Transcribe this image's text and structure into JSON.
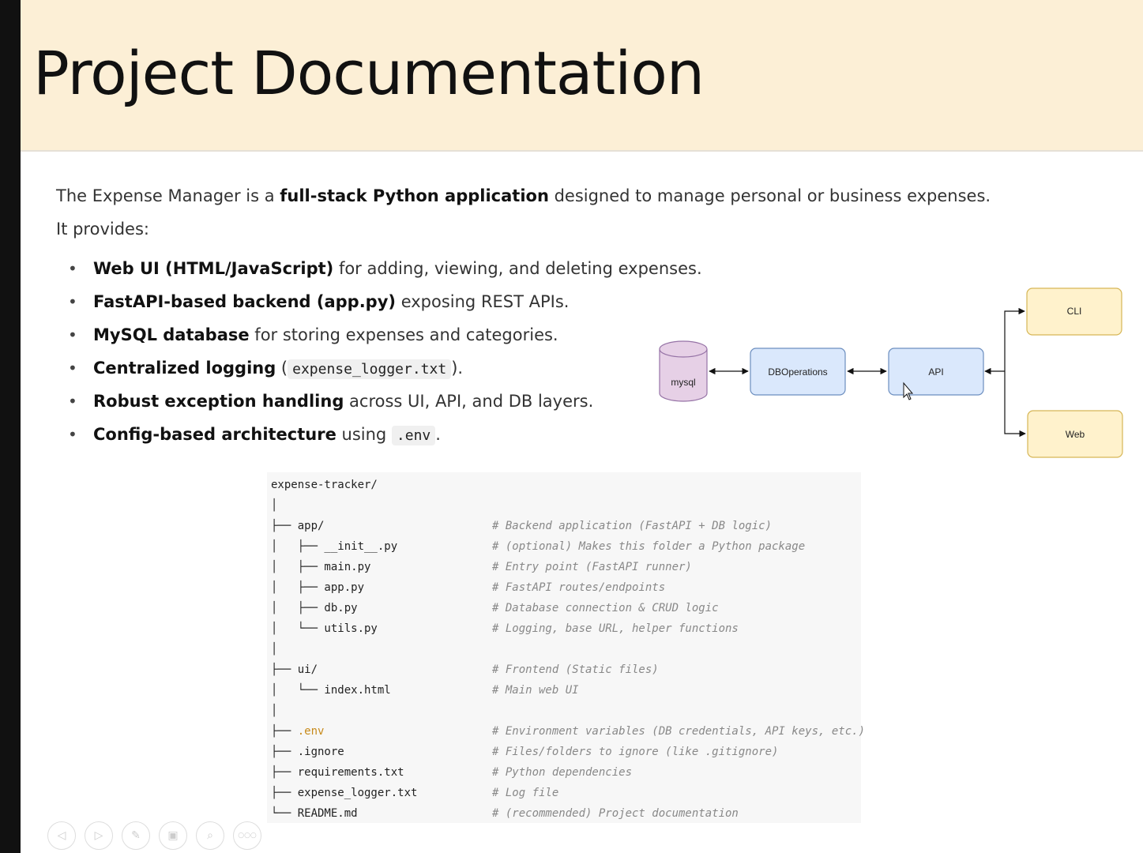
{
  "title": "Project Documentation",
  "intro": {
    "prefix": "The Expense Manager is a ",
    "bold": "full-stack Python application",
    "suffix": " designed to manage personal or business expenses.",
    "line2": "It provides:"
  },
  "bullets": [
    {
      "bold": "Web UI (HTML/JavaScript)",
      "text": " for adding, viewing, and deleting expenses."
    },
    {
      "bold": "FastAPI-based backend (app.py)",
      "text": " exposing REST APIs."
    },
    {
      "bold": "MySQL database",
      "text": " for storing expenses and categories."
    },
    {
      "bold": "Centralized logging",
      "pre": " (",
      "code": "expense_logger.txt",
      "post": ")."
    },
    {
      "bold": "Robust exception handling",
      "text": " across UI, API, and DB layers."
    },
    {
      "bold": "Config-based architecture",
      "pre": " using ",
      "code": ".env",
      "post": "."
    }
  ],
  "diagram": {
    "mysql": "mysql",
    "dbops": "DBOperations",
    "api": "API",
    "cli": "CLI",
    "web": "Web",
    "colors": {
      "db": "#e6d0e6",
      "blue": "#dae8fc",
      "blue_border": "#6c8ebf",
      "yellow": "#fff2cc",
      "yellow_border": "#d6b656",
      "purple_border": "#9673a6"
    }
  },
  "tree": {
    "rows": [
      {
        "text": "expense-tracker/",
        "comment": ""
      },
      {
        "text": "│",
        "comment": ""
      },
      {
        "text": "├── app/",
        "comment": "# Backend application (FastAPI + DB logic)"
      },
      {
        "text": "│   ├── __init__.py",
        "comment": "# (optional) Makes this folder a Python package"
      },
      {
        "text": "│   ├── main.py",
        "comment": "# Entry point (FastAPI runner)"
      },
      {
        "text": "│   ├── app.py",
        "comment": "# FastAPI routes/endpoints"
      },
      {
        "text": "│   ├── db.py",
        "comment": "# Database connection & CRUD logic"
      },
      {
        "text": "│   └── utils.py",
        "comment": "# Logging, base URL, helper functions"
      },
      {
        "text": "│",
        "comment": ""
      },
      {
        "text": "├── ui/",
        "comment": "# Frontend (Static files)"
      },
      {
        "text": "│   └── index.html",
        "comment": "# Main web UI"
      },
      {
        "text": "│",
        "comment": ""
      },
      {
        "text": "├── ",
        "env": ".env",
        "comment": "# Environment variables (DB credentials, API keys, etc.)"
      },
      {
        "text": "├── .ignore",
        "comment": "# Files/folders to ignore (like .gitignore)"
      },
      {
        "text": "├── requirements.txt",
        "comment": "# Python dependencies"
      },
      {
        "text": "├── expense_logger.txt",
        "comment": "# Log file"
      },
      {
        "text": "└── README.md",
        "comment": "# (recommended) Project documentation"
      }
    ]
  },
  "controls": {
    "icons": [
      "prev-icon",
      "next-icon",
      "pen-icon",
      "slides-icon",
      "zoom-icon",
      "more-icon"
    ],
    "glyphs": [
      "◁",
      "▷",
      "✎",
      "▣",
      "⌕",
      "○○○"
    ]
  }
}
